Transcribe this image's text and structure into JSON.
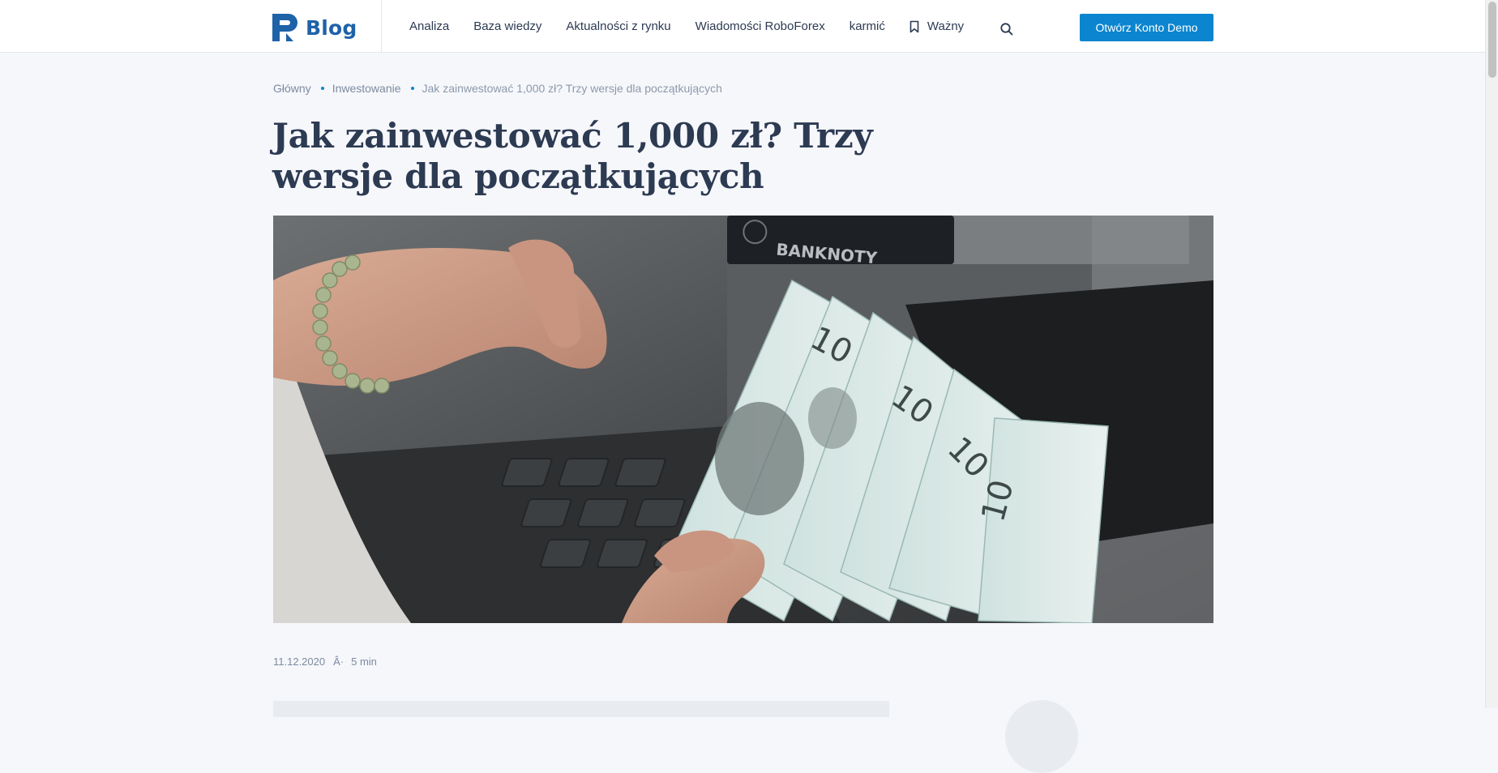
{
  "header": {
    "logo_text": "Blog",
    "nav": [
      {
        "label": "Analiza"
      },
      {
        "label": "Baza wiedzy"
      },
      {
        "label": "Aktualności z rynku"
      },
      {
        "label": "Wiadomości RoboForex"
      },
      {
        "label": "karmić"
      },
      {
        "label": "Ważny",
        "icon": "bookmark-icon"
      }
    ],
    "search_icon": "search-icon",
    "cta_label": "Otwórz Konto Demo"
  },
  "colors": {
    "brand": "#1e62a8",
    "accent": "#0b85cf",
    "text": "#2c3a52",
    "muted": "#7c8a9e",
    "background": "#f6f7fb"
  },
  "breadcrumb": [
    {
      "label": "Główny"
    },
    {
      "label": "Inwestowanie"
    },
    {
      "label": "Jak zainwestować 1,000 zł? Trzy wersje dla początkujących"
    }
  ],
  "article": {
    "title": "Jak zainwestować 1,000 zł? Trzy wersje dla początkujących",
    "image": {
      "slot_text": "BANKNOTY",
      "banknote_value": "10"
    },
    "date": "11.12.2020",
    "meta_separator": "Â·",
    "read_time": "5 min"
  }
}
